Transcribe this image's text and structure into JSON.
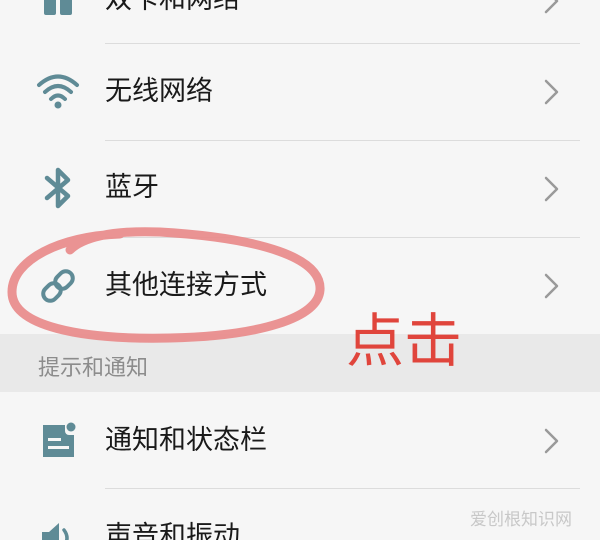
{
  "settings": {
    "rows": [
      {
        "label": "双卡和网络",
        "icon": "sim-card-icon"
      },
      {
        "label": "无线网络",
        "icon": "wifi-icon"
      },
      {
        "label": "蓝牙",
        "icon": "bluetooth-icon"
      },
      {
        "label": "其他连接方式",
        "icon": "link-icon"
      },
      {
        "label": "通知和状态栏",
        "icon": "notification-icon"
      },
      {
        "label": "声音和振动",
        "icon": "speaker-icon"
      }
    ],
    "section_header": "提示和通知"
  },
  "annotation": {
    "text": "点击",
    "color": "#e0453c"
  },
  "watermark": "爱创根知识网",
  "colors": {
    "icon": "#5f8b96",
    "background": "#f6f6f6",
    "section_bg": "#e9e9e9",
    "chevron": "#9a9a9a"
  }
}
